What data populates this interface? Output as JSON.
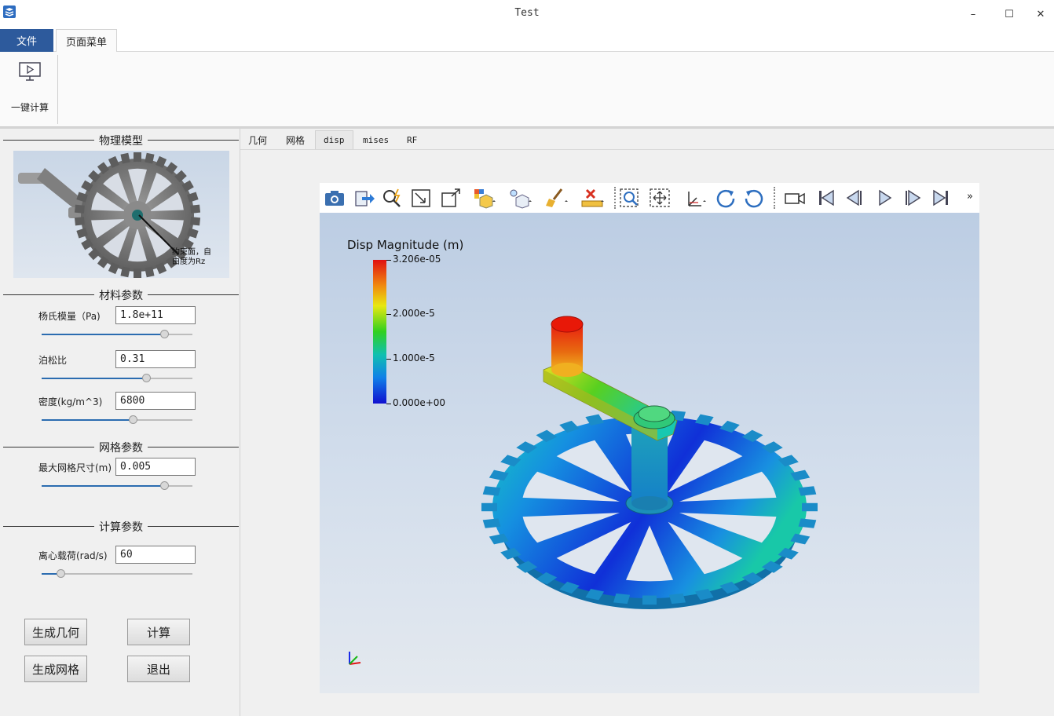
{
  "window": {
    "title": "Test",
    "min_glyph": "–",
    "max_glyph": "☐",
    "close_glyph": "✕"
  },
  "ribbon": {
    "file_tab": "文件",
    "page_tab": "页面菜单",
    "one_click_label": "一键计算"
  },
  "left": {
    "physical_model_title": "物理模型",
    "model_annotation_line1": "约束面，自",
    "model_annotation_line2": "由度为Rz",
    "material_title": "材料参数",
    "youngs_label": "杨氏模量（Pa)",
    "youngs_value": "1.8e+11",
    "youngs_slider": 0.82,
    "poisson_label": "泊松比",
    "poisson_value": "0.31",
    "poisson_slider": 0.7,
    "density_label": "密度(kg/m^3)",
    "density_value": "6800",
    "density_slider": 0.61,
    "mesh_title": "网格参数",
    "mesh_size_label": "最大网格尺寸(m)",
    "mesh_size_value": "0.005",
    "mesh_slider": 0.82,
    "calc_title": "计算参数",
    "load_label": "离心载荷(rad/s)",
    "load_value": "60",
    "load_slider": 0.13,
    "btn_geometry": "生成几何",
    "btn_calculate": "计算",
    "btn_mesh": "生成网格",
    "btn_exit": "退出"
  },
  "tabs": {
    "geometry": "几何",
    "mesh": "网格",
    "disp": "disp",
    "mises": "mises",
    "rf": "RF"
  },
  "viewer": {
    "more_glyph": "»",
    "colorbar_title": "Disp Magnitude (m)",
    "tick_max": "3.206e-05",
    "tick_2": "2.000e-5",
    "tick_1": "1.000e-5",
    "tick_0": "0.000e+00"
  },
  "colors": {
    "file_tab_bg": "#2d5a9c",
    "accent": "#2b6cb0"
  }
}
